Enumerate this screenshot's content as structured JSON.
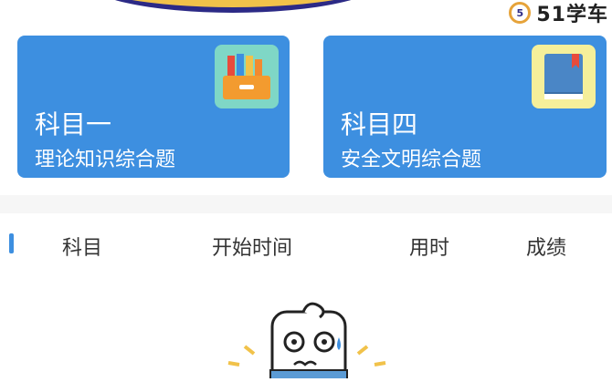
{
  "brand": {
    "logo_text": "51学车",
    "logo_badge": "5"
  },
  "cards": [
    {
      "title": "科目一",
      "subtitle": "理论知识综合题",
      "icon": "folder-icon",
      "color": "#3d8fe0"
    },
    {
      "title": "科目四",
      "subtitle": "安全文明综合题",
      "icon": "book-icon",
      "color": "#3d8fe0"
    }
  ],
  "table": {
    "headers": [
      "科目",
      "开始时间",
      "用时",
      "成绩"
    ]
  },
  "colors": {
    "accent": "#3d8fe0"
  }
}
